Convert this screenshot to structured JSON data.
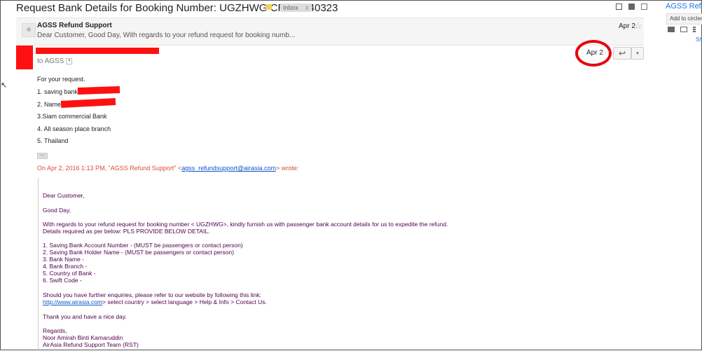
{
  "header": {
    "subject": "Request Bank Details for Booking Number: UGZHWG CRM:0540323",
    "inbox_label": "Inbox",
    "inbox_remove": "x"
  },
  "collapsed_message": {
    "sender": "AGSS Refund Support",
    "snippet": "Dear Customer, Good Day, With regards to your refund request for booking numb...",
    "date": "Apr 2",
    "star": "☆"
  },
  "open_message": {
    "to": "to AGSS",
    "date": "Apr 2",
    "star": "☆",
    "reply_icon": "↩",
    "more_icon": "▾",
    "body_lines": [
      "For your request.",
      "1.  saving bank",
      "2. Name",
      "3.Siam commercial Bank",
      "4. All season place branch",
      "5. Thailand"
    ],
    "ellipsis": "...",
    "quote_header_prefix": "On Apr 2, 2016 1:13 PM, \"AGSS Refund Support\" <",
    "quote_header_email": "agss_refundsupport@airasia.com",
    "quote_header_suffix": "> wrote:",
    "quoted": {
      "greeting": "Dear Customer,",
      "good_day": "Good Day,",
      "para1": "With regards to your refund request for booking number < UGZHWG>, kindly furnish us with passenger bank account details for us to expedite the refund.",
      "para2": "Details required as per below: PLS PROVIDE BELOW DETAIL.",
      "items": [
        "1. Saving Bank Account Number - (MUST be passengers or contact person)",
        "2. Saving Bank Holder Name - (MUST be passengers or contact person)",
        "3. Bank Name -",
        "4. Bank Branch -",
        "5. Country of Bank -",
        "6. Swift Code -"
      ],
      "enquiries": "Should you have further enquiries, please refer to our website by following this link:",
      "link": "http://www.airasia.com",
      "link_suffix": "> select country > select language > Help & Info > Contact Us.",
      "thanks": "Thank you and have a nice day.",
      "regards": "Regards,",
      "signer": "Noor Amirah Binti Kamaruddin",
      "team": "AirAsia Refund Support Team (RST)"
    }
  },
  "sidebar": {
    "title": "AGSS Refu",
    "add_button": "Add to circles",
    "link_text": "Sh"
  },
  "colors": {
    "redaction": "#ff1010",
    "highlight_circle": "#e8000d",
    "quote_text": "#500050",
    "link": "#1155cc"
  }
}
